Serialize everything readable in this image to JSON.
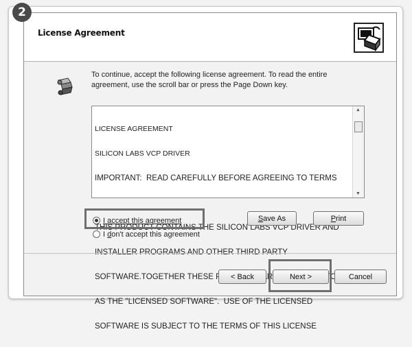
{
  "step_badge": "2",
  "dialog": {
    "title": "License Agreement",
    "header_icon": "computer-box-icon",
    "body_icon": "license-scroll-icon",
    "intro_text": "To continue, accept the following license agreement. To read the entire agreement, use the scroll bar or press the Page Down key.",
    "license_lines": [
      "LICENSE AGREEMENT",
      "SILICON LABS VCP DRIVER",
      "IMPORTANT:  READ CAREFULLY BEFORE AGREEING TO TERMS",
      "",
      "THIS PRODUCT CONTAINS THE SILICON LABS VCP DRIVER AND",
      "INSTALLER PROGRAMS AND OTHER THIRD PARTY",
      "SOFTWARE.TOGETHER THESE PRODUCTS ARE REFERRED TO",
      "AS THE \"LICENSED SOFTWARE\".  USE OF THE LICENSED",
      "SOFTWARE IS SUBJECT TO THE TERMS OF THIS LICENSE"
    ],
    "radio_accept": {
      "underline": "I",
      "rest": " accept this agreement",
      "checked": true
    },
    "radio_decline": {
      "prefix": "I ",
      "underline": "d",
      "rest": "on't accept this agreement",
      "checked": false
    },
    "buttons": {
      "save_as": {
        "underline": "S",
        "rest": "ave As"
      },
      "print": {
        "underline": "P",
        "rest": "rint"
      },
      "back": "< Back",
      "next": "Next >",
      "cancel": "Cancel"
    },
    "colors": {
      "highlight_box": "#6e6e6e",
      "dialog_bg": "#f2f2f2",
      "header_bg": "#ffffff"
    }
  }
}
